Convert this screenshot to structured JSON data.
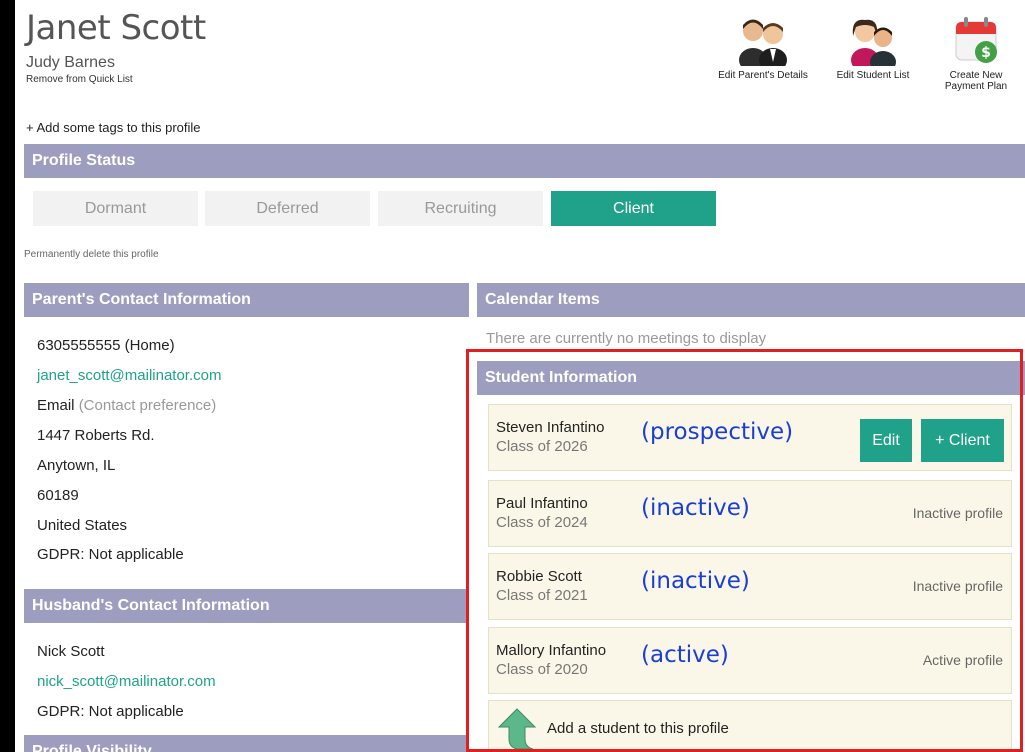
{
  "profile": {
    "name": "Janet Scott",
    "subname": "Judy Barnes",
    "remove_link": "Remove from Quick List",
    "add_tags": "+ Add some tags to this profile",
    "delete_link": "Permanently delete this profile"
  },
  "actions": [
    {
      "label": "Edit Parent's Details",
      "icon": "parents-icon"
    },
    {
      "label": "Edit Student List",
      "icon": "students-icon"
    },
    {
      "label": "Create New Payment Plan",
      "icon": "payment-calendar-icon"
    }
  ],
  "status": {
    "title": "Profile Status",
    "options": [
      "Dormant",
      "Deferred",
      "Recruiting",
      "Client"
    ],
    "selected": "Client"
  },
  "parent_contact": {
    "title": "Parent's Contact Information",
    "phone": "6305555555 (Home)",
    "email": "janet_scott@mailinator.com",
    "pref_label": "Email",
    "pref_note": "(Contact preference)",
    "address1": "1447 Roberts Rd.",
    "city": "Anytown, IL",
    "zip": "60189",
    "country": "United States",
    "gdpr": "GDPR:  Not applicable"
  },
  "husband_contact": {
    "title": "Husband's Contact Information",
    "name": "Nick Scott",
    "email": "nick_scott@mailinator.com",
    "gdpr": "GDPR:  Not applicable"
  },
  "visibility": {
    "title": "Profile Visibility"
  },
  "calendar": {
    "title": "Calendar Items",
    "empty": "There are currently no meetings to display"
  },
  "students": {
    "title": "Student Information",
    "edit_label": "Edit",
    "client_label": "+ Client",
    "items": [
      {
        "name": "Steven Infantino",
        "class": "Class of 2026",
        "note": "(prospective)",
        "status": ""
      },
      {
        "name": "Paul Infantino",
        "class": "Class of 2024",
        "note": "(inactive)",
        "status": "Inactive profile"
      },
      {
        "name": "Robbie Scott",
        "class": "Class of 2021",
        "note": "(inactive)",
        "status": "Inactive profile"
      },
      {
        "name": "Mallory Infantino",
        "class": "Class of 2020",
        "note": "(active)",
        "status": "Active profile"
      }
    ],
    "add_label": "Add a student to this profile"
  },
  "colors": {
    "header_bar": "#9d9dbf",
    "accent": "#20a28a",
    "annotation": "#1a3fd8",
    "highlight_box": "#e02020",
    "card_bg": "#fbf7e8"
  }
}
